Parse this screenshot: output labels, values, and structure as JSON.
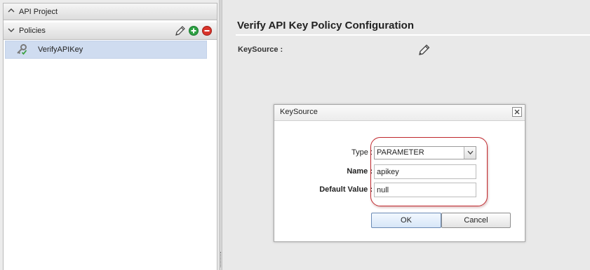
{
  "sidebar": {
    "project_header": {
      "label": "API Project",
      "icon": "chevron-up-icon"
    },
    "policies_header": {
      "label": "Policies",
      "icon": "chevron-down-icon"
    },
    "actions": [
      {
        "name": "edit-policy-icon",
        "color": "#555555"
      },
      {
        "name": "add-policy-icon",
        "color": "#2ea043"
      },
      {
        "name": "remove-policy-icon",
        "color": "#d9342b"
      }
    ],
    "policy_item": {
      "label": "VerifyAPIKey",
      "icon": "key-check-icon",
      "selected": true
    }
  },
  "main": {
    "title": "Verify API Key Policy Configuration",
    "keysource_label": "KeySource :",
    "edit_icon": "pencil-icon"
  },
  "dialog": {
    "title": "KeySource",
    "close_icon": "close-icon",
    "type_label": "Type :",
    "type_value": "PARAMETER",
    "name_label": "Name :",
    "name_value": "apikey",
    "default_label": "Default Value :",
    "default_value": "null",
    "ok_label": "OK",
    "cancel_label": "Cancel",
    "highlight_color": "#c0282d"
  }
}
